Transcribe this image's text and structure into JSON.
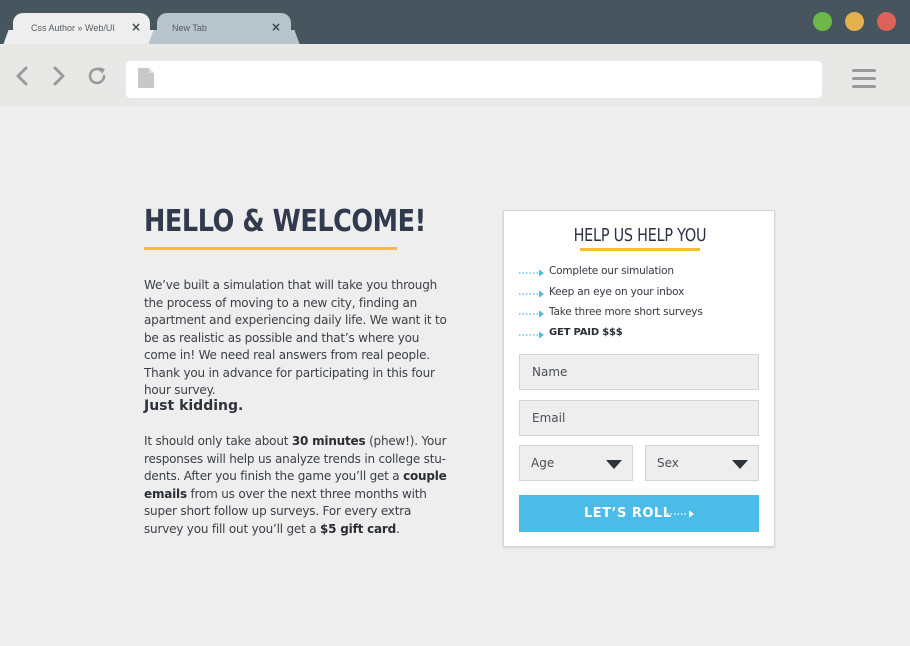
{
  "browser": {
    "tabs": [
      {
        "label": "Css Author » Web/UI",
        "active": true
      },
      {
        "label": "New Tab",
        "active": false
      }
    ],
    "tab_close_label": "×",
    "window_controls": {
      "green": "#6cb84b",
      "yellow": "#e6b04c",
      "red": "#dc625a"
    },
    "toolbar": {
      "back_icon": "chevron-left-icon",
      "forward_icon": "chevron-right-icon",
      "reload_icon": "reload-icon",
      "address_value": "",
      "menu_icon": "hamburger-menu-icon"
    }
  },
  "page": {
    "heading": "HELLO & WELCOME!",
    "intro": "We’ve built a simulation that will take you through the process of moving to a new city, finding an apartment and experiencing daily life. We want it to be as realistic as possible and that’s where you come in! We need real answers from real people. Thank you in advance for participating in this four hour survey.",
    "subheading": "Just kidding.",
    "detail": {
      "p1": "It should only take about ",
      "b1": "30 minutes",
      "p2": " (phew!). Your responses will help us analyze trends in college stu-dents. After you finish the game you’ll get a ",
      "b2": "couple emails",
      "p3": " from us over the next three months with super short follow up surveys. For every extra survey you fill out you’ll get a ",
      "b3": "$5 gift card",
      "p4": "."
    }
  },
  "form": {
    "title": "HELP US HELP YOU",
    "steps": [
      "Complete our simulation",
      "Keep an eye on your inbox",
      "Take three more short surveys",
      "GET PAID $$$"
    ],
    "name_placeholder": "Name",
    "email_placeholder": "Email",
    "age_label": "Age",
    "sex_label": "Sex",
    "submit_label": "LET’S ROLL"
  },
  "colors": {
    "accent_yellow": "#f5c02a",
    "button_blue": "#4bbbe8",
    "titlebar": "#47565e",
    "heading_text": "#323a4d"
  }
}
